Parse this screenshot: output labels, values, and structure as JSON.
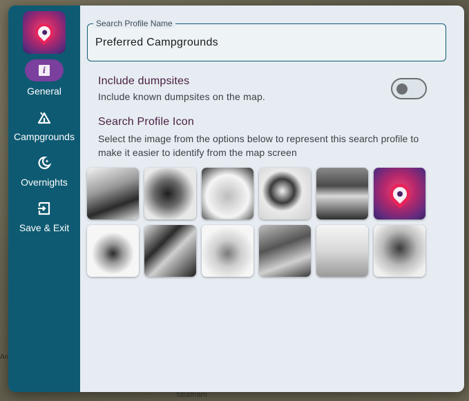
{
  "map": {
    "label_bottom": "Stratham",
    "label_left": "An"
  },
  "sidebar": {
    "items": [
      {
        "label": "General",
        "icon": "info-icon",
        "active": true
      },
      {
        "label": "Campgrounds",
        "icon": "tent-icon",
        "active": false
      },
      {
        "label": "Overnights",
        "icon": "moon-stars-icon",
        "active": false
      },
      {
        "label": "Save & Exit",
        "icon": "exit-icon",
        "active": false
      }
    ]
  },
  "form": {
    "name_label": "Search Profile Name",
    "name_value": "Preferred Campgrounds",
    "dumpsites": {
      "title": "Include dumpsites",
      "description": "Include known dumpsites on the map.",
      "enabled": false
    },
    "icon_section": {
      "title": "Search Profile Icon",
      "description": "Select the image from the options below to represent this search profile to make it easier to identify from the map screen",
      "icons": [
        "house-bw-icon",
        "bottle-bw-icon",
        "camper-bw-icon",
        "magnifier-bw-icon",
        "lake-bw-icon",
        "app-logo-color-icon",
        "explosion-bw-icon",
        "sign-bw-icon",
        "piggybank-bw-icon",
        "city-bw-icon",
        "station-bw-icon",
        "kids-bw-icon"
      ]
    }
  },
  "colors": {
    "sidebar": "#0e5a72",
    "active_pill": "#7b3f9e",
    "content_bg": "#e6ecf2",
    "heading": "#4a1e3e"
  }
}
